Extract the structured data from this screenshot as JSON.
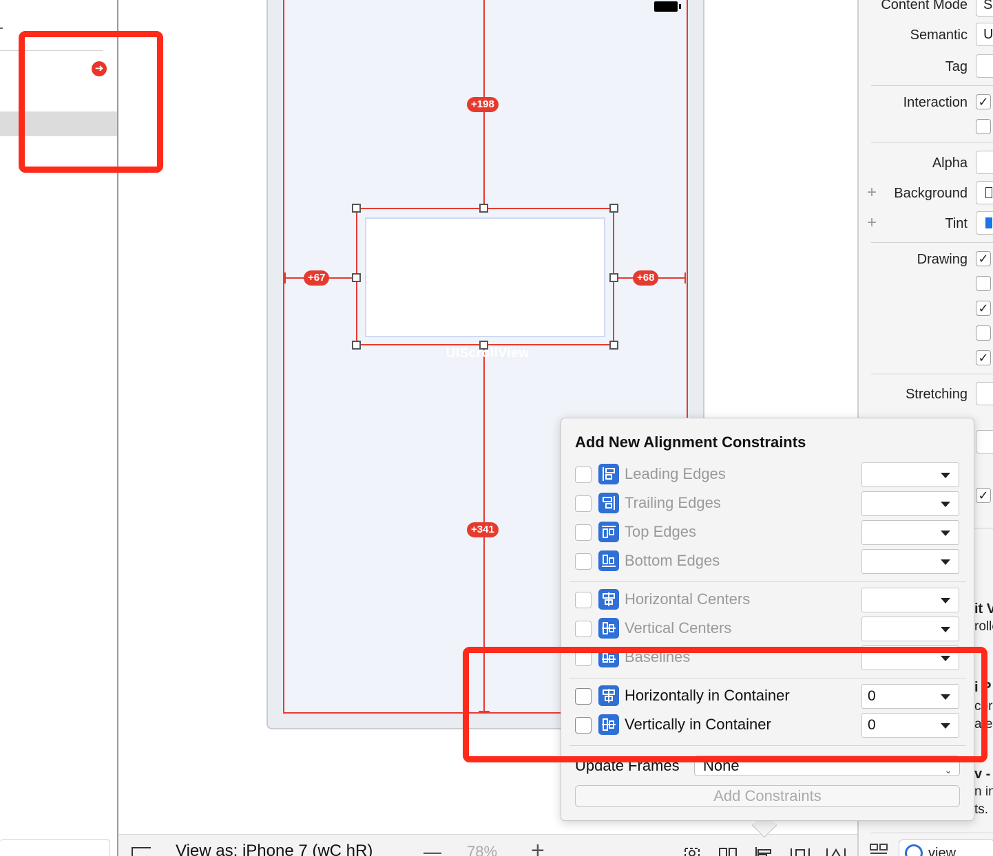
{
  "navigator": {
    "error_glyph": "➜"
  },
  "canvas": {
    "constraints": {
      "top": "+198",
      "left": "+67",
      "right": "+68",
      "bottom": "+341"
    },
    "scroll_view_label": "UIScrollView"
  },
  "bottom_bar": {
    "view_as": "View as: iPhone 7 (wC hR)",
    "zoom": "78%",
    "minus": "−",
    "plus": "+"
  },
  "inspector": {
    "labels": {
      "content_mode": "Content Mode",
      "semantic": "Semantic",
      "tag": "Tag",
      "interaction": "Interaction",
      "alpha": "Alpha",
      "background": "Background",
      "tint": "Tint",
      "drawing": "Drawing",
      "stretching": "Stretching"
    },
    "field_values": {
      "content_mode": "S",
      "semantic": "U"
    },
    "background_plus": "+",
    "tint_plus": "+",
    "check": "✓",
    "tint_color": "#1a73e8",
    "peek_texts": [
      "it V",
      "rolle",
      "i P",
      "cor",
      "a e",
      "v -",
      "n in",
      "ts."
    ],
    "footer_tab": "view"
  },
  "popover": {
    "title": "Add New Alignment Constraints",
    "rows": [
      {
        "label": "Leading Edges",
        "value": ""
      },
      {
        "label": "Trailing Edges",
        "value": ""
      },
      {
        "label": "Top Edges",
        "value": ""
      },
      {
        "label": "Bottom Edges",
        "value": ""
      },
      {
        "label": "Horizontal Centers",
        "value": ""
      },
      {
        "label": "Vertical Centers",
        "value": ""
      },
      {
        "label": "Baselines",
        "value": ""
      },
      {
        "label": "Horizontally in Container",
        "value": "0"
      },
      {
        "label": "Vertically in Container",
        "value": "0"
      }
    ],
    "update_frames_label": "Update Frames",
    "update_frames_value": "None",
    "add_button": "Add Constraints"
  },
  "colors": {
    "constraint_red": "#e53b2f",
    "annotation_red": "#ff2a1a",
    "icon_blue": "#2f6fd6"
  }
}
